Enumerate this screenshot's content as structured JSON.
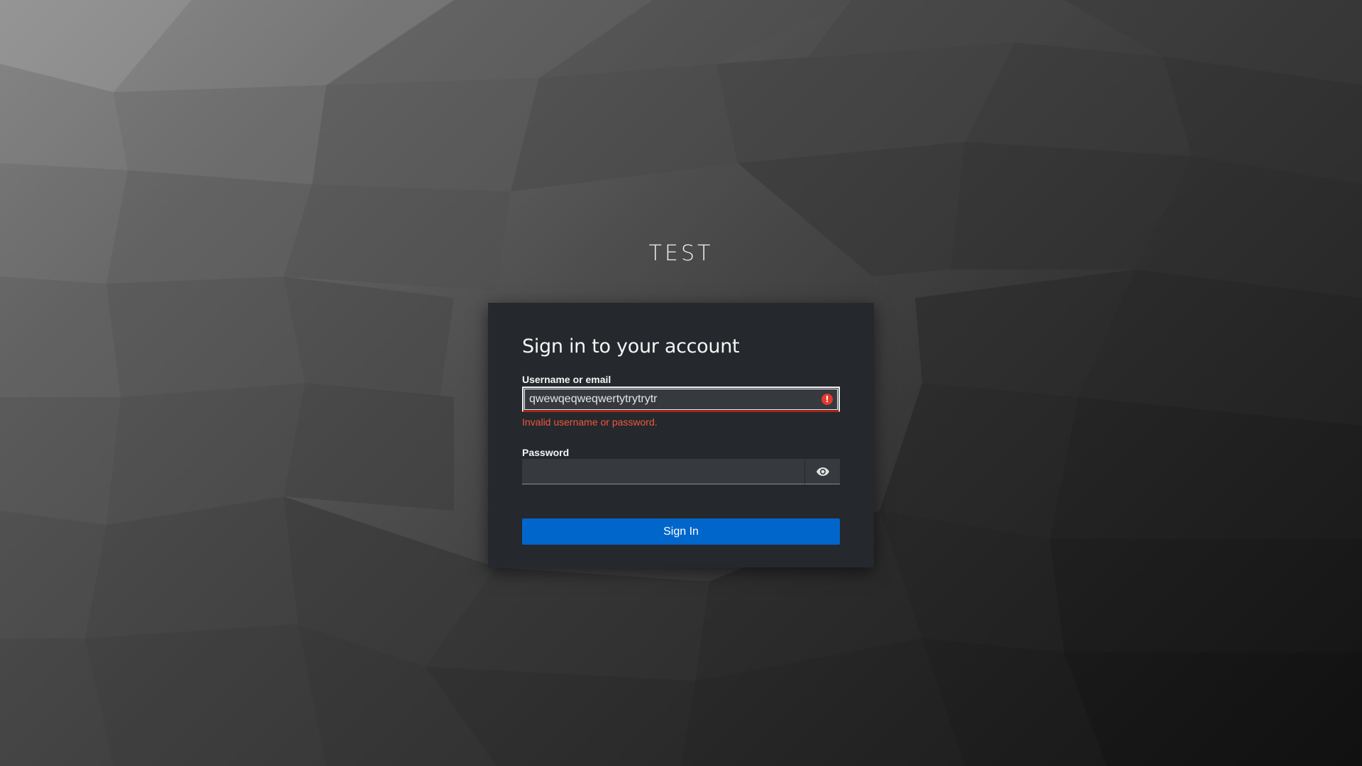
{
  "brand": {
    "name": "TEST"
  },
  "login": {
    "title": "Sign in to your account",
    "username_label": "Username or email",
    "username_value": "qwewqeqweqwertytrytrytr",
    "error_message": "Invalid username or password.",
    "password_label": "Password",
    "password_value": "",
    "show_password_icon": "eye-icon",
    "error_icon": "exclamation-circle-icon",
    "submit_label": "Sign In"
  },
  "colors": {
    "primary": "#0066cc",
    "error": "#c9190b",
    "card_background": "#25282c"
  }
}
